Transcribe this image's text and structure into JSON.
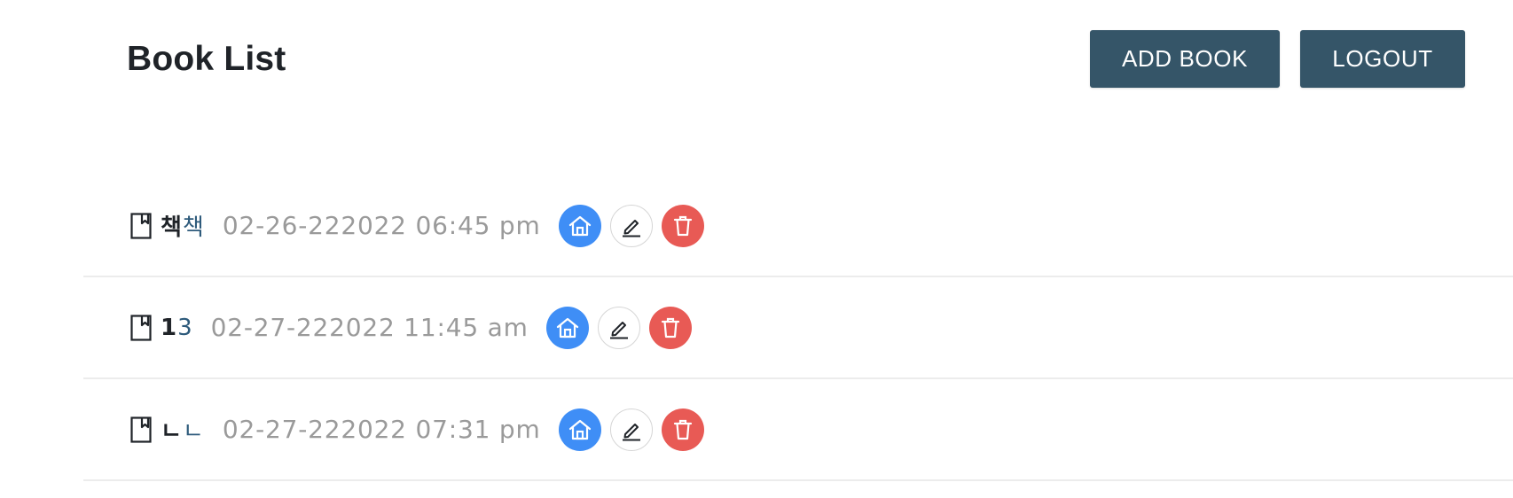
{
  "header": {
    "title": "Book List",
    "add_book_label": "ADD BOOK",
    "logout_label": "LOGOUT"
  },
  "colors": {
    "button_bg": "#355568",
    "home_button": "#3f8ef6",
    "delete_button": "#e85a55",
    "date_text": "#9a9a9a"
  },
  "books": [
    {
      "title_bold": "책",
      "title_light": "책",
      "date": "02-26-222022 06:45 pm"
    },
    {
      "title_bold": "1",
      "title_light": "3",
      "date": "02-27-222022 11:45 am"
    },
    {
      "title_bold": "ㄴ",
      "title_light": "ㄴ",
      "date": "02-27-222022 07:31 pm"
    }
  ],
  "icons": {
    "book": "book-bookmark-icon",
    "home": "home-icon",
    "edit": "pencil-icon",
    "delete": "trash-icon"
  }
}
